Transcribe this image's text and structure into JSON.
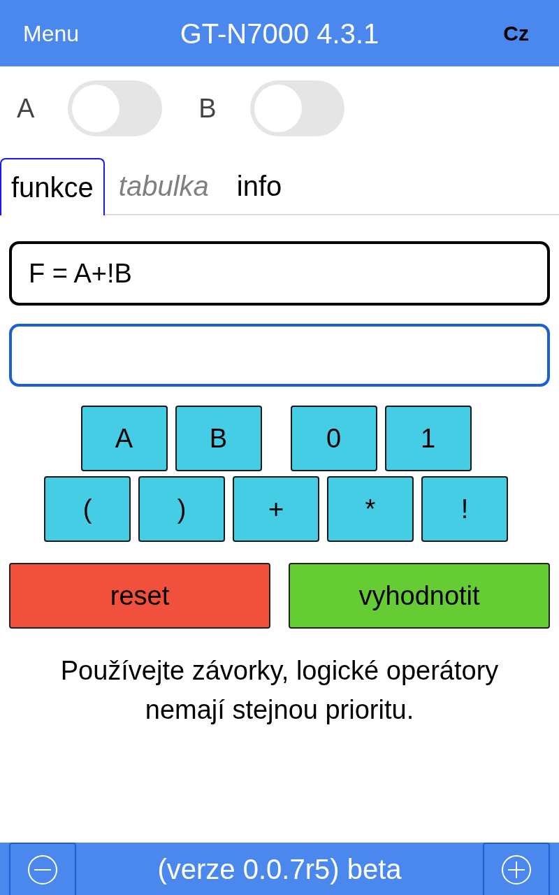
{
  "header": {
    "menu": "Menu",
    "title": "GT-N7000 4.3.1",
    "language": "Cz"
  },
  "switches": [
    {
      "label": "A",
      "on": false
    },
    {
      "label": "B",
      "on": false
    }
  ],
  "tabs": [
    {
      "label": "funkce",
      "selected": true,
      "disabled": false
    },
    {
      "label": "tabulka",
      "selected": false,
      "disabled": true
    },
    {
      "label": "info",
      "selected": false,
      "disabled": false
    }
  ],
  "fields": [
    {
      "value": "F = A+!B",
      "focused": false
    },
    {
      "focused": true
    }
  ],
  "keypad_rows": [
    [
      [
        "A",
        "B"
      ],
      [
        "0",
        "1"
      ]
    ],
    [
      [
        "(",
        ")",
        "+",
        "*",
        "!"
      ]
    ]
  ],
  "actions": [
    {
      "label": "reset",
      "color": "#f0503c"
    },
    {
      "label": "vyhodnotit",
      "color": "#66cc33"
    }
  ],
  "hint": "Používejte závorky, logické operátory nemají stejnou prioritu.",
  "footer": {
    "text": "(verze 0.0.7r5) beta"
  }
}
